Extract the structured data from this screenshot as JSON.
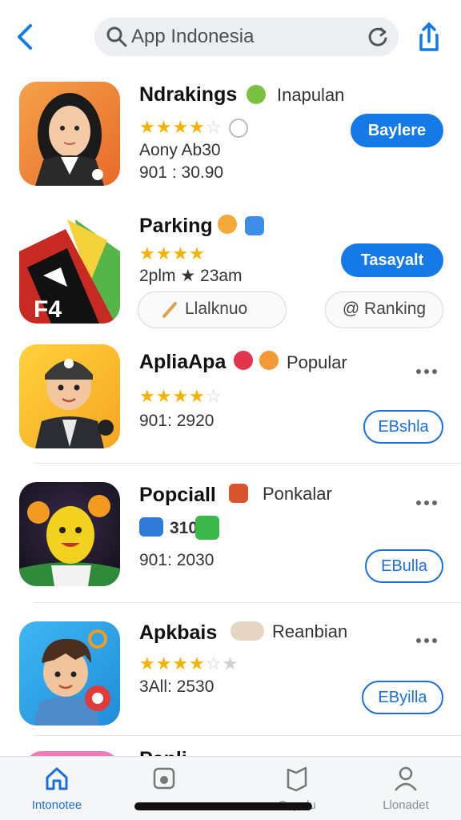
{
  "search": {
    "value": "App Indonesia"
  },
  "apps": [
    {
      "name": "Ndrakings",
      "tag": "Inapulan",
      "rating": 3.5,
      "line1": "Aony Ab30",
      "line2": "901 : 30.90",
      "button": "Baylere"
    },
    {
      "name": "Parking",
      "rating": 4,
      "line1": "2plm ★ 23am",
      "button": "Tasayalt",
      "chip1": "Llalknuo",
      "chip2": "@ Ranking"
    },
    {
      "name": "ApliaApa",
      "tag": "Popular",
      "rating": 3.5,
      "line2": "901: 2920",
      "button": "EBshla"
    },
    {
      "name": "Popciall",
      "tag": "Ponkalar",
      "line1": "310",
      "line2": "901: 2030",
      "button": "EBulla"
    },
    {
      "name": "Apkbais",
      "tag": "Reanbian",
      "rating": 3.5,
      "line2": "3All: 2530",
      "button": "EByilla"
    }
  ],
  "peek_row_title": "Panli",
  "tabs": [
    {
      "label": "Intonotee",
      "active": true
    },
    {
      "label": ""
    },
    {
      "label": "Copulu"
    },
    {
      "label": "Llonadet"
    }
  ],
  "colors": {
    "accent": "#1579e6",
    "star": "#f2b200"
  }
}
